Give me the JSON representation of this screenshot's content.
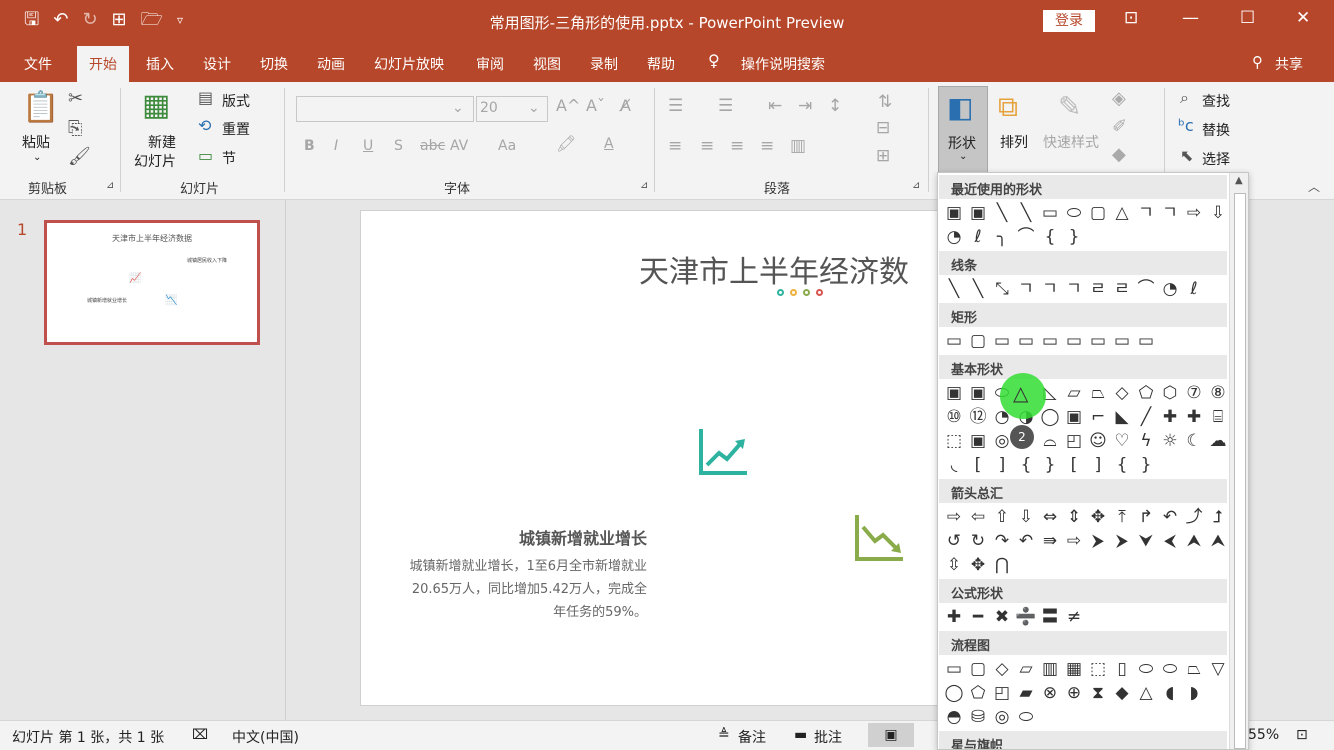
{
  "titlebar": {
    "doc_title": "常用图形-三角形的使用.pptx  -  PowerPoint Preview",
    "login_label": "登录",
    "qat_icons": [
      "save-icon",
      "undo-icon",
      "redo-icon",
      "present-icon",
      "open-icon",
      "customize-icon"
    ]
  },
  "tabs": [
    "文件",
    "开始",
    "插入",
    "设计",
    "切换",
    "动画",
    "幻灯片放映",
    "审阅",
    "视图",
    "录制",
    "帮助",
    "操作说明搜索",
    "共享"
  ],
  "active_tab": "开始",
  "ribbon": {
    "clipboard": {
      "paste": "粘贴",
      "group": "剪贴板"
    },
    "slides": {
      "new_slide_1": "新建",
      "new_slide_2": "幻灯片",
      "layout": "版式",
      "reset": "重置",
      "section": "节",
      "group": "幻灯片"
    },
    "font": {
      "font_size": "20",
      "group": "字体",
      "bold": "B",
      "italic": "I",
      "underline": "U",
      "shadow": "S",
      "strike": "abc",
      "spacing": "AV",
      "case": "Aa",
      "highlight": "A"
    },
    "paragraph": {
      "group": "段落"
    },
    "drawing": {
      "shapes": "形状",
      "arrange": "排列",
      "quick_styles": "快速样式"
    },
    "editing": {
      "find": "查找",
      "replace": "替换",
      "select": "选择"
    }
  },
  "thumbnail": {
    "number": "1",
    "title": "天津市上半年经济数据",
    "block1_title": "城镇新增就业增长",
    "block2_title": "城镇居民收入下降"
  },
  "slide": {
    "title": "天津市上半年经济数",
    "heading": "城镇新增就业增长",
    "body_lines": [
      "城镇新增就业增长，1至6月全市新增就业",
      "20.65万人，同比增加5.42万人，完成全",
      "年任务的59%。"
    ],
    "dot_colors": [
      "#2eb3a0",
      "#f0b03c",
      "#8aab4a",
      "#d9534f"
    ],
    "teal": "#2eb3a0",
    "green": "#8aab4a"
  },
  "gallery": {
    "categories": [
      "最近使用的形状",
      "线条",
      "矩形",
      "基本形状",
      "箭头总汇",
      "公式形状",
      "流程图",
      "星与旗帜"
    ],
    "recent_shapes": [
      "▣",
      "▣",
      "╲",
      "╲",
      "▭",
      "⬭",
      "▢",
      "△",
      "ㄱ",
      "ㄱ",
      "⇨",
      "⇩"
    ],
    "recent_shapes2": [
      "◔",
      "ℓ",
      "╮",
      "⌒",
      "{",
      "}"
    ],
    "line_shapes": [
      "╲",
      "╲",
      "⤡",
      "ㄱ",
      "ㄱ",
      "ㄱ",
      "ㄹ",
      "ㄹ",
      "⌒",
      "◔",
      "ℓ"
    ],
    "rect_shapes": [
      "▭",
      "▢",
      "▭",
      "▭",
      "▭",
      "▭",
      "▭",
      "▭",
      "▭"
    ],
    "basic1": [
      "▣",
      "▣",
      "⬭",
      "△",
      "◺",
      "▱",
      "⏢",
      "◇",
      "⬠",
      "⬡",
      "⑦",
      "⑧"
    ],
    "basic2": [
      "⑩",
      "⑫",
      "◔",
      "◑",
      "◯",
      "▣",
      "⌐",
      "◣",
      "╱",
      "✚",
      "✚",
      "⌸"
    ],
    "basic3": [
      "⬚",
      "▣",
      "◎",
      "⊘",
      "⌓",
      "◰",
      "☺",
      "♡",
      "ϟ",
      "☼",
      "☾",
      "☁"
    ],
    "basic4": [
      "◟",
      "[",
      "]",
      "{",
      "}",
      "[",
      "]",
      "{",
      "}"
    ],
    "arrows1": [
      "⇨",
      "⇦",
      "⇧",
      "⇩",
      "⇔",
      "⇕",
      "✥",
      "⤒",
      "↱",
      "↶",
      "⤴",
      "⮥"
    ],
    "arrows2": [
      "↺",
      "↻",
      "↷",
      "↶",
      "⇛",
      "⇨",
      "⮞",
      "⮞",
      "⮟",
      "⮜",
      "⮝",
      "⮝"
    ],
    "arrows3": [
      "⇳",
      "✥",
      "⋂"
    ],
    "equation": [
      "✚",
      "━",
      "✖",
      "➗",
      "〓",
      "≠"
    ],
    "flow1": [
      "▭",
      "▢",
      "◇",
      "▱",
      "▥",
      "▦",
      "⬚",
      "▯",
      "⬭",
      "⬭",
      "⏢",
      "▽"
    ],
    "flow2": [
      "◯",
      "⬠",
      "◰",
      "▰",
      "⊗",
      "⊕",
      "⧗",
      "◆",
      "△",
      "◖",
      "◗"
    ],
    "flow3": [
      "◓",
      "⛁",
      "◎",
      "⬭"
    ],
    "cursor_badge": "2"
  },
  "status": {
    "slide_info": "幻灯片 第 1 张，共 1 张",
    "language": "中文(中国)",
    "notes": "备注",
    "comments": "批注",
    "zoom": "55%"
  },
  "colors": {
    "accent": "#b7472a",
    "highlight": "#33dd33"
  }
}
